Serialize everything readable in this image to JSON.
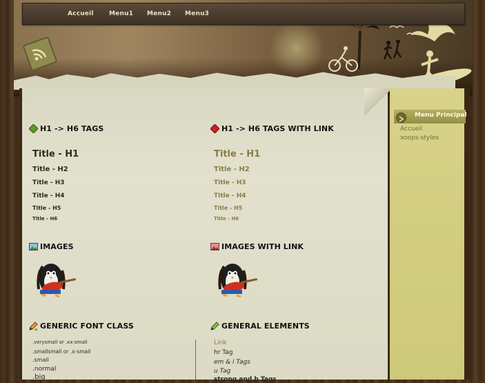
{
  "nav": {
    "items": [
      "Accueil",
      "Menu1",
      "Menu2",
      "Menu3"
    ]
  },
  "sections": {
    "headings": {
      "title": "H1 -> H6 TAGS",
      "items": [
        "Title - H1",
        "Title - H2",
        "Title - H3",
        "Title - H4",
        "Title - H5",
        "Title - H6"
      ]
    },
    "headings_link": {
      "title": "H1 -> H6 TAGS WITH LINK",
      "items": [
        "Title - H1",
        "Title - H2",
        "Title - H3",
        "Title - H4",
        "Title - H5",
        "Title - H6"
      ]
    },
    "images": {
      "title": "IMAGES"
    },
    "images_link": {
      "title": "IMAGES WITH LINK"
    },
    "font_class": {
      "title": "GENERIC FONT CLASS",
      "items": [
        ".verysmall or .xx-small",
        ".smallsmall or .x-small",
        ".small",
        ".normal",
        ".big"
      ]
    },
    "general": {
      "title": "GENERAL ELEMENTS",
      "items": [
        "Link",
        "hr Tag",
        "em & i Tags",
        "u Tag",
        "strong and b Tags"
      ]
    }
  },
  "sidebar": {
    "menu_title": "Menu Principal",
    "links": [
      "Accueil",
      "xoops-styles"
    ]
  },
  "icons": {
    "rss": "rss-icon",
    "heading": "green-diamond-icon",
    "heading_link": "red-diamond-icon",
    "image": "image-icon",
    "image_link": "image-link-icon",
    "font": "pencil-icon",
    "general": "pencil-icon",
    "menu_arrow": "arrow-right-circle-icon"
  },
  "colors": {
    "accent": "#8a7a4a",
    "sidebar": "#d8d389",
    "content_bg": "#dcdac5"
  }
}
